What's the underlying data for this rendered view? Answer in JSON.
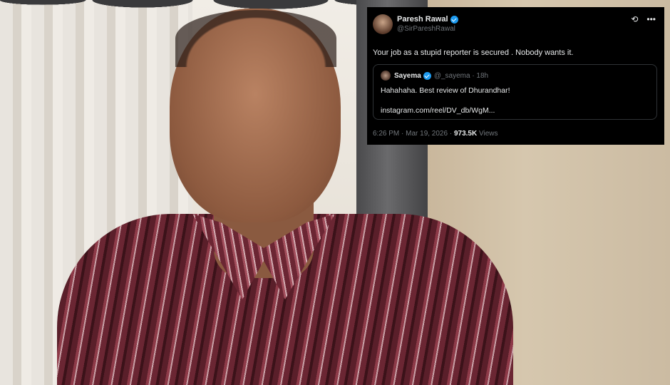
{
  "tweet": {
    "author_name": "Paresh Rawal",
    "author_handle": "@SirPareshRawal",
    "text": "Your job as a stupid reporter is secured . Nobody wants it.",
    "quoted": {
      "name": "Sayema",
      "handle": "@_sayema · 18h",
      "text": "Hahahaha. Best review of Dhurandhar!",
      "link": "instagram.com/reel/DV_db/WgM..."
    },
    "time": "6:26 PM · Mar 19, 2026 · ",
    "views_count": "973.5K",
    "views_label": " Views",
    "icons": {
      "grok": "grok-icon",
      "more": "more-options-icon",
      "verified": "verified-badge-icon"
    }
  },
  "colors": {
    "tweet_bg": "#000000",
    "text": "#e7e9ea",
    "muted": "#71767b",
    "verified": "#1d9bf0"
  }
}
